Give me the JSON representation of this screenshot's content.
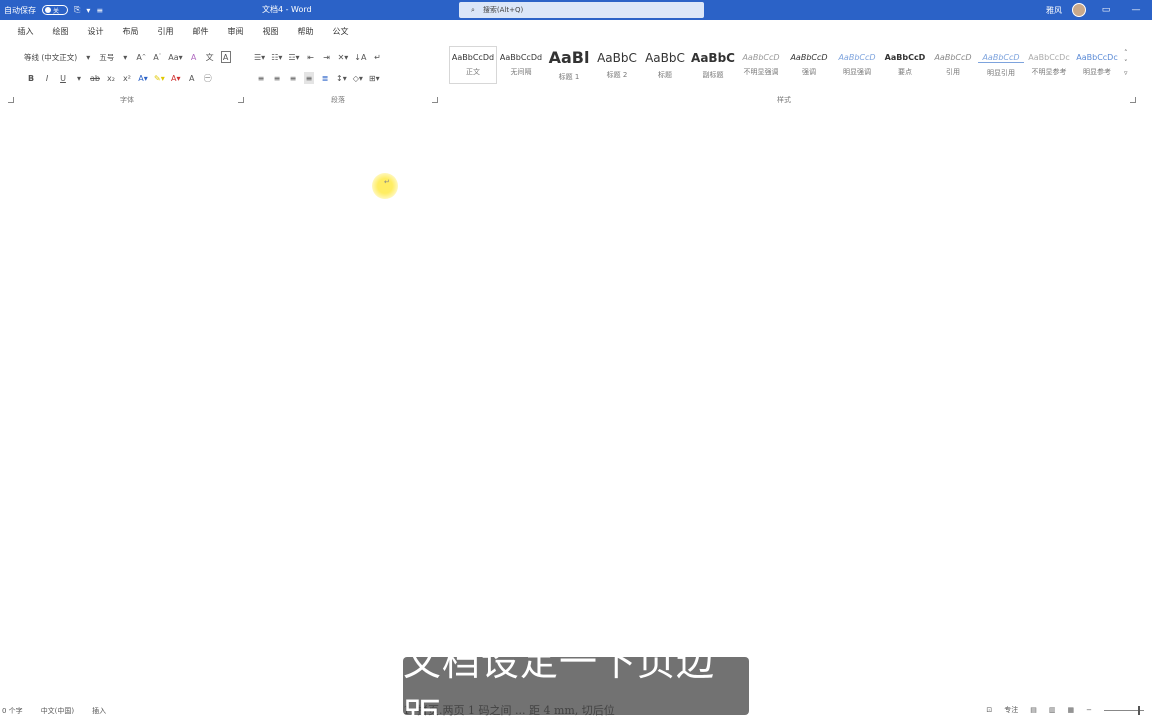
{
  "titlebar": {
    "autosave_label": "自动保存",
    "autosave_state": "关",
    "doc_title": "文档4 - Word",
    "search_placeholder": "搜索(Alt+Q)",
    "user_name": "雅风",
    "accent": "#2b62c7"
  },
  "menu": {
    "tabs": [
      "插入",
      "绘图",
      "设计",
      "布局",
      "引用",
      "邮件",
      "审阅",
      "视图",
      "帮助",
      "公文"
    ]
  },
  "ribbon": {
    "font_name": "等线 (中文正文)",
    "font_size": "五号",
    "groups": {
      "font": "字体",
      "paragraph": "段落",
      "styles": "样式"
    },
    "styles": [
      {
        "preview": "AaBbCcDd",
        "label": "正文"
      },
      {
        "preview": "AaBbCcDd",
        "label": "无间隔"
      },
      {
        "preview": "AaBl",
        "label": "标题 1"
      },
      {
        "preview": "AaBbC",
        "label": "标题 2"
      },
      {
        "preview": "AaBbC",
        "label": "标题"
      },
      {
        "preview": "AaBbC",
        "label": "副标题"
      },
      {
        "preview": "AaBbCcD",
        "label": "不明显强调"
      },
      {
        "preview": "AaBbCcD",
        "label": "强调"
      },
      {
        "preview": "AaBbCcD",
        "label": "明显强调"
      },
      {
        "preview": "AaBbCcD",
        "label": "要点"
      },
      {
        "preview": "AaBbCcD",
        "label": "引用"
      },
      {
        "preview": "AaBbCcD",
        "label": "明显引用"
      },
      {
        "preview": "AaBbCcDc",
        "label": "不明显参考"
      },
      {
        "preview": "AaBbCcDc",
        "label": "明显参考"
      }
    ]
  },
  "document": {
    "bottom_line": "1. 拼页.两页 1 码之间 ... 距 4 mm, 切后位"
  },
  "subtitle": "文档设定一下页边距",
  "status": {
    "words": "0 个字",
    "language": "中文(中国)",
    "mode": "插入",
    "focus": "专注"
  }
}
